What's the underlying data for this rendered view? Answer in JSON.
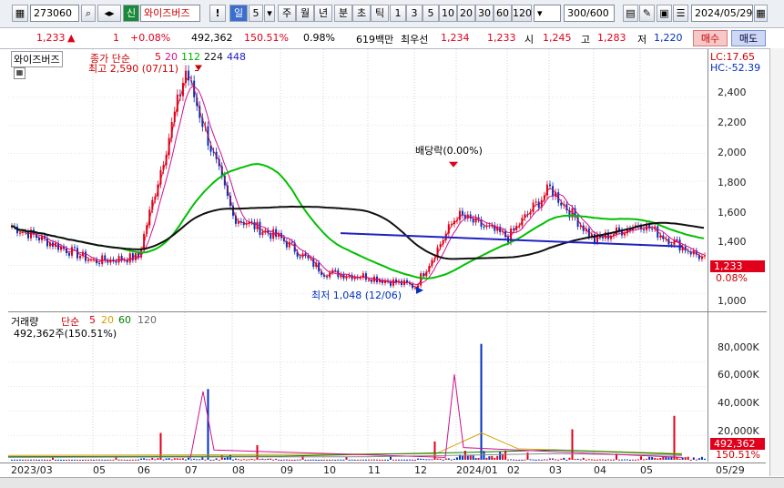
{
  "toolbar": {
    "code": "273060",
    "market_badge": "신",
    "stock_name": "와이즈버즈",
    "alert": "!",
    "period_day": "일",
    "period_num": "5",
    "week": "주",
    "month": "월",
    "year": "년",
    "minute": "분",
    "second": "초",
    "tick": "틱",
    "nums": [
      "1",
      "3",
      "5",
      "10",
      "20",
      "30",
      "60",
      "120"
    ],
    "count": "300/600",
    "date": "2024/05/29"
  },
  "quote": {
    "price": "1,233",
    "change": "1",
    "change_pct": "+0.08%",
    "volume": "492,362",
    "vol_ratio": "150.51%",
    "turnover": "0.98%",
    "amount": "619백만",
    "priority_label": "최우선",
    "ask": "1,234",
    "bid": "1,233",
    "open_label": "시",
    "open": "1,245",
    "high_label": "고",
    "high": "1,283",
    "low_label": "저",
    "low": "1,220",
    "buy": "매수",
    "sell": "매도"
  },
  "price_panel": {
    "name": "와이즈버즈",
    "legend_prefix": "종가 단순",
    "ma": [
      "5",
      "20",
      "112",
      "224",
      "448"
    ],
    "lc": "LC:17.65",
    "hc": "HC:-52.39",
    "high_note": "최고 2,590 (07/11)",
    "low_note": "최저 1,048 (12/06)",
    "dividend": "배당락(0.00%)",
    "current": "1,233",
    "current_pct": "0.08%",
    "marker": "B",
    "ticks": [
      "2,400",
      "2,200",
      "2,000",
      "1,800",
      "1,600",
      "1,400",
      "1,200",
      "1,000"
    ]
  },
  "volume_panel": {
    "name": "거래량",
    "legend_prefix": "단순",
    "ma": [
      "5",
      "20",
      "60",
      "120"
    ],
    "info": "492,362주(150.51%)",
    "ticks": [
      "80,000K",
      "60,000K",
      "40,000K",
      "20,000K"
    ],
    "current": "492,362",
    "current_pct": "150.51%"
  },
  "xaxis": [
    "2023/03",
    "05",
    "06",
    "07",
    "08",
    "09",
    "10",
    "11",
    "12",
    "2024/01",
    "02",
    "03",
    "04",
    "05",
    "05/29"
  ],
  "colors": {
    "up": "#e0001b",
    "down": "#0030c0",
    "ma5": "#e0001b",
    "ma20": "#d01090",
    "ma112": "#00c000",
    "ma224": "#101010",
    "ma448": "#2020c0"
  },
  "chart_data": [
    {
      "type": "line",
      "title": "",
      "ylim": [
        950,
        2600
      ],
      "x": [
        "2023/03",
        "05",
        "06",
        "07",
        "08",
        "09",
        "10",
        "11",
        "12",
        "2024/01",
        "02",
        "03",
        "04",
        "05",
        "05/29"
      ],
      "series": [
        {
          "name": "종가",
          "values": [
            1480,
            1230,
            1260,
            2590,
            1550,
            1390,
            1150,
            1120,
            1050,
            1560,
            1400,
            1750,
            1380,
            1500,
            1233
          ]
        }
      ]
    },
    {
      "type": "bar",
      "title": "",
      "ylim": [
        0,
        100000
      ],
      "x": [
        "2023/03",
        "05",
        "06",
        "07",
        "08",
        "09",
        "10",
        "11",
        "12",
        "2024/01",
        "02",
        "03",
        "04",
        "05",
        "05/29"
      ],
      "series": [
        {
          "name": "거래량",
          "values": [
            2000,
            2500,
            22000,
            58000,
            12000,
            3000,
            2500,
            3000,
            15000,
            95000,
            6000,
            25000,
            5000,
            36000,
            492
          ]
        }
      ]
    }
  ]
}
